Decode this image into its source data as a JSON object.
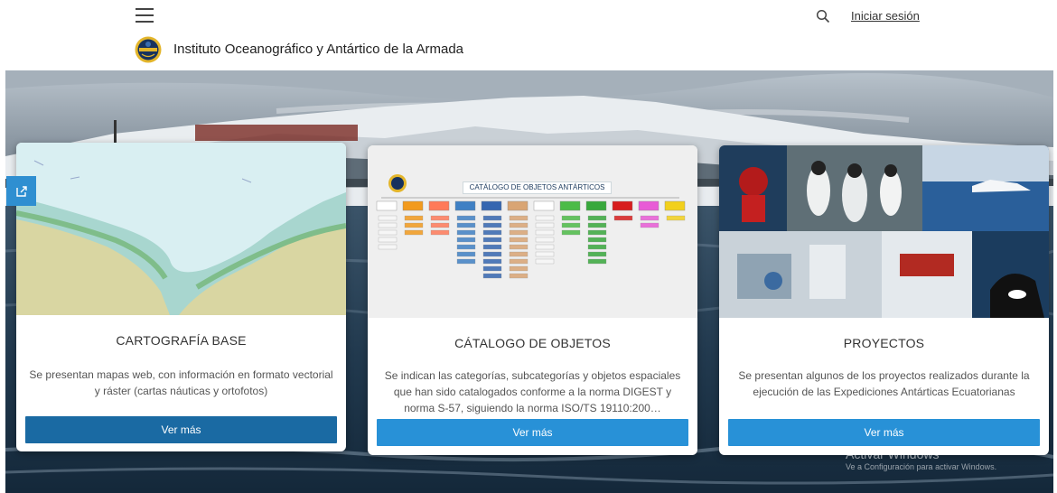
{
  "header": {
    "menu_icon": "hamburger-menu-icon",
    "search_icon": "search-icon",
    "signin_label": "Iniciar sesión",
    "org_title": "Instituto Oceanográfico y Antártico de la Armada",
    "logo_icon": "institute-seal-logo"
  },
  "side_tab": {
    "icon": "external-link-icon"
  },
  "cards": [
    {
      "title": "CARTOGRAFÍA BASE",
      "description": "Se presentan mapas web, con información en formato vectorial y ráster (cartas náuticas y ortofotos)",
      "button_label": "Ver más"
    },
    {
      "title": "CÁTALOGO DE OBJETOS",
      "description": "Se indican las categorías, subcategorías y objetos espaciales que han sido catalogados conforme a la norma DIGEST y norma S-57, siguiendo la norma ISO/TS 19110:200…",
      "button_label": "Ver más",
      "image_title": "CATÁLOGO  DE OBJETOS ANTÁRTICOS"
    },
    {
      "title": "PROYECTOS",
      "description": "Se presentan algunos de los proyectos realizados durante la ejecución de las Expediciones Antárticas Ecuatorianas",
      "button_label": "Ver más"
    }
  ],
  "watermark": {
    "line1": "Activar Windows",
    "line2": "Ve a Configuración para activar Windows."
  },
  "colors": {
    "primary_button": "#2891d7",
    "active_button": "#1a6aa3",
    "side_tab": "#2f8fd1"
  }
}
